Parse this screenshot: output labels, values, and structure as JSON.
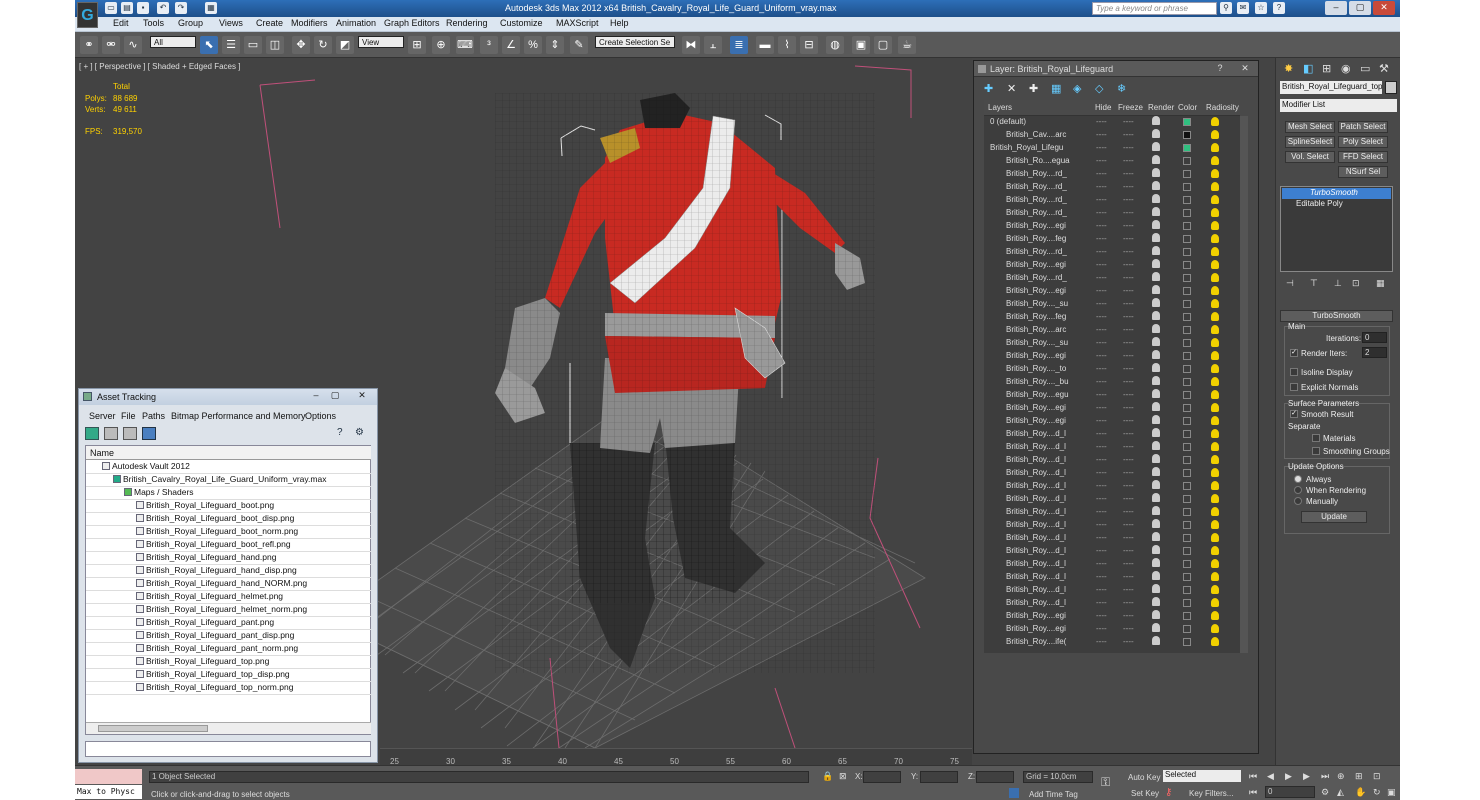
{
  "window": {
    "title": "Autodesk 3ds Max  2012 x64     British_Cavalry_Royal_Life_Guard_Uniform_vray.max",
    "search_placeholder": "Type a keyword or phrase"
  },
  "menu": [
    "Edit",
    "Tools",
    "Group",
    "Views",
    "Create",
    "Modifiers",
    "Animation",
    "Graph Editors",
    "Rendering",
    "Customize",
    "MAXScript",
    "Help"
  ],
  "toolbar": {
    "filter_value": "All",
    "coord_value": "View",
    "selection_set_placeholder": "Create Selection Se"
  },
  "viewport": {
    "label": "[ + ] [ Perspective ] [ Shaded + Edged Faces ]",
    "stats": {
      "total_label": "Total",
      "polys_label": "Polys:",
      "polys_value": "88 689",
      "verts_label": "Verts:",
      "verts_value": "49 611",
      "fps_label": "FPS:",
      "fps_value": "319,570"
    }
  },
  "asset_tracking": {
    "title": "Asset Tracking",
    "menu": [
      "Server",
      "File",
      "Paths",
      "Bitmap Performance and Memory",
      "Options"
    ],
    "column": "Name",
    "vault": "Autodesk Vault 2012",
    "scene_file": "British_Cavalry_Royal_Life_Guard_Uniform_vray.max",
    "folder": "Maps / Shaders",
    "files": [
      "British_Royal_Lifeguard_boot.png",
      "British_Royal_Lifeguard_boot_disp.png",
      "British_Royal_Lifeguard_boot_norm.png",
      "British_Royal_Lifeguard_boot_refl.png",
      "British_Royal_Lifeguard_hand.png",
      "British_Royal_Lifeguard_hand_disp.png",
      "British_Royal_Lifeguard_hand_NORM.png",
      "British_Royal_Lifeguard_helmet.png",
      "British_Royal_Lifeguard_helmet_norm.png",
      "British_Royal_Lifeguard_pant.png",
      "British_Royal_Lifeguard_pant_disp.png",
      "British_Royal_Lifeguard_pant_norm.png",
      "British_Royal_Lifeguard_top.png",
      "British_Royal_Lifeguard_top_disp.png",
      "British_Royal_Lifeguard_top_norm.png"
    ]
  },
  "layer_manager": {
    "title": "Layer: British_Royal_Lifeguard",
    "columns": [
      "Layers",
      "Hide",
      "Freeze",
      "Render",
      "Color",
      "Radiosity"
    ],
    "hide_freeze_glyph": "----",
    "rows": [
      {
        "name": "0 (default)",
        "level": 0,
        "color": "#30c080"
      },
      {
        "name": "British_Cav....arc",
        "level": 1,
        "color": "#111111"
      },
      {
        "name": "British_Royal_Lifegu",
        "level": 0,
        "color": "#30c080"
      },
      {
        "name": "British_Ro....egua",
        "level": 1,
        "color": ""
      },
      {
        "name": "British_Roy....rd_",
        "level": 1,
        "color": ""
      },
      {
        "name": "British_Roy....rd_",
        "level": 1,
        "color": ""
      },
      {
        "name": "British_Roy....rd_",
        "level": 1,
        "color": ""
      },
      {
        "name": "British_Roy....rd_",
        "level": 1,
        "color": ""
      },
      {
        "name": "British_Roy....egi",
        "level": 1,
        "color": ""
      },
      {
        "name": "British_Roy....feg",
        "level": 1,
        "color": ""
      },
      {
        "name": "British_Roy....rd_",
        "level": 1,
        "color": ""
      },
      {
        "name": "British_Roy....egi",
        "level": 1,
        "color": ""
      },
      {
        "name": "British_Roy....rd_",
        "level": 1,
        "color": ""
      },
      {
        "name": "British_Roy....egi",
        "level": 1,
        "color": ""
      },
      {
        "name": "British_Roy...._su",
        "level": 1,
        "color": ""
      },
      {
        "name": "British_Roy....feg",
        "level": 1,
        "color": ""
      },
      {
        "name": "British_Roy....arc",
        "level": 1,
        "color": ""
      },
      {
        "name": "British_Roy...._su",
        "level": 1,
        "color": ""
      },
      {
        "name": "British_Roy....egi",
        "level": 1,
        "color": ""
      },
      {
        "name": "British_Roy...._to",
        "level": 1,
        "color": ""
      },
      {
        "name": "British_Roy...._bu",
        "level": 1,
        "color": ""
      },
      {
        "name": "British_Roy....egu",
        "level": 1,
        "color": ""
      },
      {
        "name": "British_Roy....egi",
        "level": 1,
        "color": ""
      },
      {
        "name": "British_Roy....egi",
        "level": 1,
        "color": ""
      },
      {
        "name": "British_Roy....d_l",
        "level": 1,
        "color": ""
      },
      {
        "name": "British_Roy....d_l",
        "level": 1,
        "color": ""
      },
      {
        "name": "British_Roy....d_l",
        "level": 1,
        "color": ""
      },
      {
        "name": "British_Roy....d_l",
        "level": 1,
        "color": ""
      },
      {
        "name": "British_Roy....d_l",
        "level": 1,
        "color": ""
      },
      {
        "name": "British_Roy....d_l",
        "level": 1,
        "color": ""
      },
      {
        "name": "British_Roy....d_l",
        "level": 1,
        "color": ""
      },
      {
        "name": "British_Roy....d_l",
        "level": 1,
        "color": ""
      },
      {
        "name": "British_Roy....d_l",
        "level": 1,
        "color": ""
      },
      {
        "name": "British_Roy....d_l",
        "level": 1,
        "color": ""
      },
      {
        "name": "British_Roy....d_l",
        "level": 1,
        "color": ""
      },
      {
        "name": "British_Roy....d_l",
        "level": 1,
        "color": ""
      },
      {
        "name": "British_Roy....d_l",
        "level": 1,
        "color": ""
      },
      {
        "name": "British_Roy....d_l",
        "level": 1,
        "color": ""
      },
      {
        "name": "British_Roy....egi",
        "level": 1,
        "color": ""
      },
      {
        "name": "British_Roy....egi",
        "level": 1,
        "color": ""
      },
      {
        "name": "British_Roy....ife(",
        "level": 1,
        "color": ""
      }
    ]
  },
  "command_panel": {
    "object_name": "British_Royal_Lifeguard_top_",
    "modifier_list": "Modifier List",
    "modifier_buttons": [
      "Mesh Select",
      "Patch Select",
      "SplineSelect",
      "Poly Select",
      "Vol. Select",
      "FFD Select",
      "NSurf Sel"
    ],
    "stack": [
      "TurboSmooth",
      "Editable Poly"
    ],
    "rollout_title": "TurboSmooth",
    "main_label": "Main",
    "iterations_label": "Iterations:",
    "iterations_value": "0",
    "render_iters_label": "Render Iters:",
    "render_iters_value": "2",
    "isoline_label": "Isoline Display",
    "explicit_label": "Explicit Normals",
    "surface_label": "Surface Parameters",
    "smooth_label": "Smooth Result",
    "separate_label": "Separate",
    "materials_label": "Materials",
    "smoothing_label": "Smoothing Groups",
    "update_label": "Update Options",
    "always_label": "Always",
    "when_render_label": "When Rendering",
    "manually_label": "Manually",
    "update_button": "Update"
  },
  "timeline": {
    "ticks": [
      "25",
      "30",
      "35",
      "40",
      "45",
      "50",
      "55",
      "60",
      "65",
      "70",
      "75"
    ]
  },
  "statusbar": {
    "script_listener": "Max to Physc",
    "selected": "1 Object Selected",
    "prompt": "Click or click-and-drag to select objects",
    "x_label": "X:",
    "y_label": "Y:",
    "z_label": "Z:",
    "grid": "Grid = 10,0cm",
    "add_time_tag": "Add Time Tag",
    "auto_key": "Auto Key",
    "auto_key_value": "Selected",
    "set_key": "Set Key",
    "key_filters": "Key Filters...",
    "frame_value": "0"
  }
}
